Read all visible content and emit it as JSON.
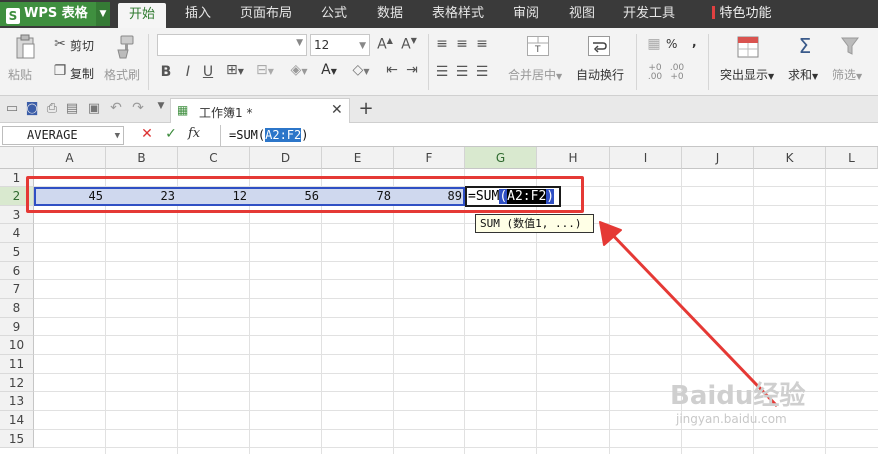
{
  "app": {
    "logo_letter": "S",
    "title": "WPS 表格"
  },
  "menu": {
    "tabs": [
      "开始",
      "插入",
      "页面布局",
      "公式",
      "数据",
      "表格样式",
      "审阅",
      "视图",
      "开发工具",
      "特色功能"
    ],
    "active": "开始"
  },
  "ribbon": {
    "paste": "粘贴",
    "cut": "剪切",
    "copy": "复制",
    "format_painter": "格式刷",
    "font_name": "",
    "font_size": "12",
    "merge_center": "合并居中",
    "wrap_text": "自动换行",
    "percent": "%",
    "comma": ",",
    "highlight": "突出显示",
    "sum": "求和",
    "filter": "筛选"
  },
  "doc": {
    "tab_title": "工作簿1 *"
  },
  "formula_bar": {
    "name_box": "AVERAGE",
    "fx": "fx",
    "formula_prefix": "=SUM(",
    "formula_ref": "A2:F2",
    "formula_suffix": ")"
  },
  "grid": {
    "columns": [
      "A",
      "B",
      "C",
      "D",
      "E",
      "F",
      "G",
      "H",
      "I",
      "J",
      "K",
      "L"
    ],
    "selected_column": "G",
    "rows": [
      "1",
      "2",
      "3",
      "4",
      "5",
      "6",
      "7",
      "8",
      "9",
      "10",
      "11",
      "12",
      "13",
      "14",
      "15"
    ],
    "selected_row": "2",
    "row2_values": [
      "45",
      "23",
      "12",
      "56",
      "78",
      "89"
    ],
    "active_cell": {
      "prefix": "=SUM",
      "open": "(",
      "ref": "A2:F2",
      "close": ")"
    },
    "tooltip": "SUM (数值1, ...)"
  },
  "watermark": {
    "brand": "Baidu经验",
    "url": "jingyan.baidu.com"
  },
  "colors": {
    "menu_bg": "#3a3a3a",
    "wps_green": "#3f8f3f",
    "selection_border": "#2f4fc4",
    "annotation_red": "#e53935"
  }
}
